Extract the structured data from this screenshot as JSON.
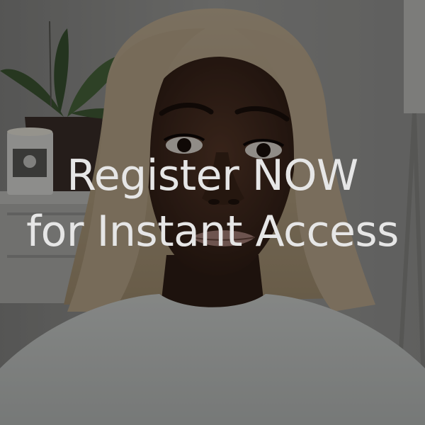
{
  "cta": {
    "line1": "Register NOW",
    "line2": "for Instant Access"
  },
  "colors": {
    "text": "#e6e6e6",
    "overlay": "rgba(0,0,0,0.38)"
  }
}
